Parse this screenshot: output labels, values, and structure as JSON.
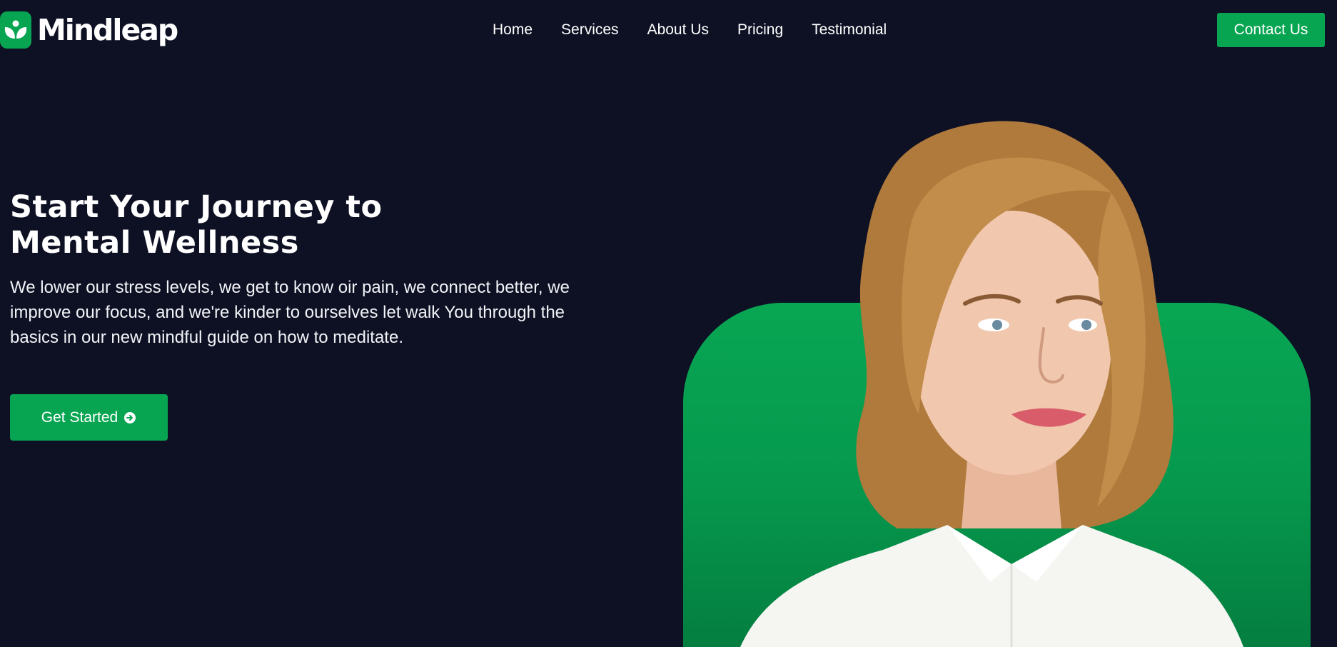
{
  "brand": {
    "name": "Mindleap"
  },
  "nav": {
    "items": [
      {
        "label": "Home"
      },
      {
        "label": "Services"
      },
      {
        "label": "About Us"
      },
      {
        "label": "Pricing"
      },
      {
        "label": "Testimonial"
      }
    ],
    "contact_label": "Contact Us"
  },
  "hero": {
    "title_line1": "Start Your Journey to",
    "title_line2": "Mental Wellness",
    "description": "We lower our stress levels, we get to know oir pain, we connect better, we improve our focus, and we're kinder to ourselves let walk You through the basics in our new mindful guide on how to meditate.",
    "cta_label": "Get Started",
    "cta_icon": "arrow-circle-right-icon"
  },
  "colors": {
    "background": "#0e1124",
    "accent": "#07a552"
  }
}
